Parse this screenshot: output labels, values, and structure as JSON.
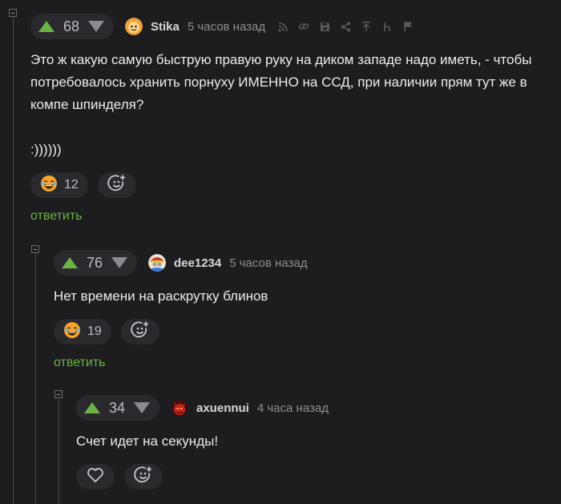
{
  "colors": {
    "background": "#1d1d20",
    "pill": "#2a2a2e",
    "upvote": "#6ab344",
    "reply_link": "#6ab344",
    "muted": "#8d8d93"
  },
  "comments": [
    {
      "rating": "68",
      "author": "Stika",
      "time": "5 часов назад",
      "text_lines": [
        "Это ж какую самую быструю правую руку на диком западе надо иметь, - чтобы",
        "потребовалось хранить порнуху ИМЕННО на ССД, при наличии прям тут же в",
        "компе шпинделя?",
        "",
        ":))))))"
      ],
      "reaction_count": "12",
      "reply_label": "ответить",
      "tool_icons": [
        "rss-icon",
        "link-icon",
        "save-icon",
        "share-icon",
        "arrow-up-icon",
        "letter-h-icon",
        "flag-icon"
      ]
    },
    {
      "rating": "76",
      "author": "dee1234",
      "time": "5 часов назад",
      "text_lines": [
        "Нет времени на раскрутку блинов"
      ],
      "reaction_count": "19",
      "reply_label": "ответить"
    },
    {
      "rating": "34",
      "author": "axuennui",
      "time": "4 часа назад",
      "text_lines": [
        "Счет идет на секунды!"
      ]
    }
  ]
}
